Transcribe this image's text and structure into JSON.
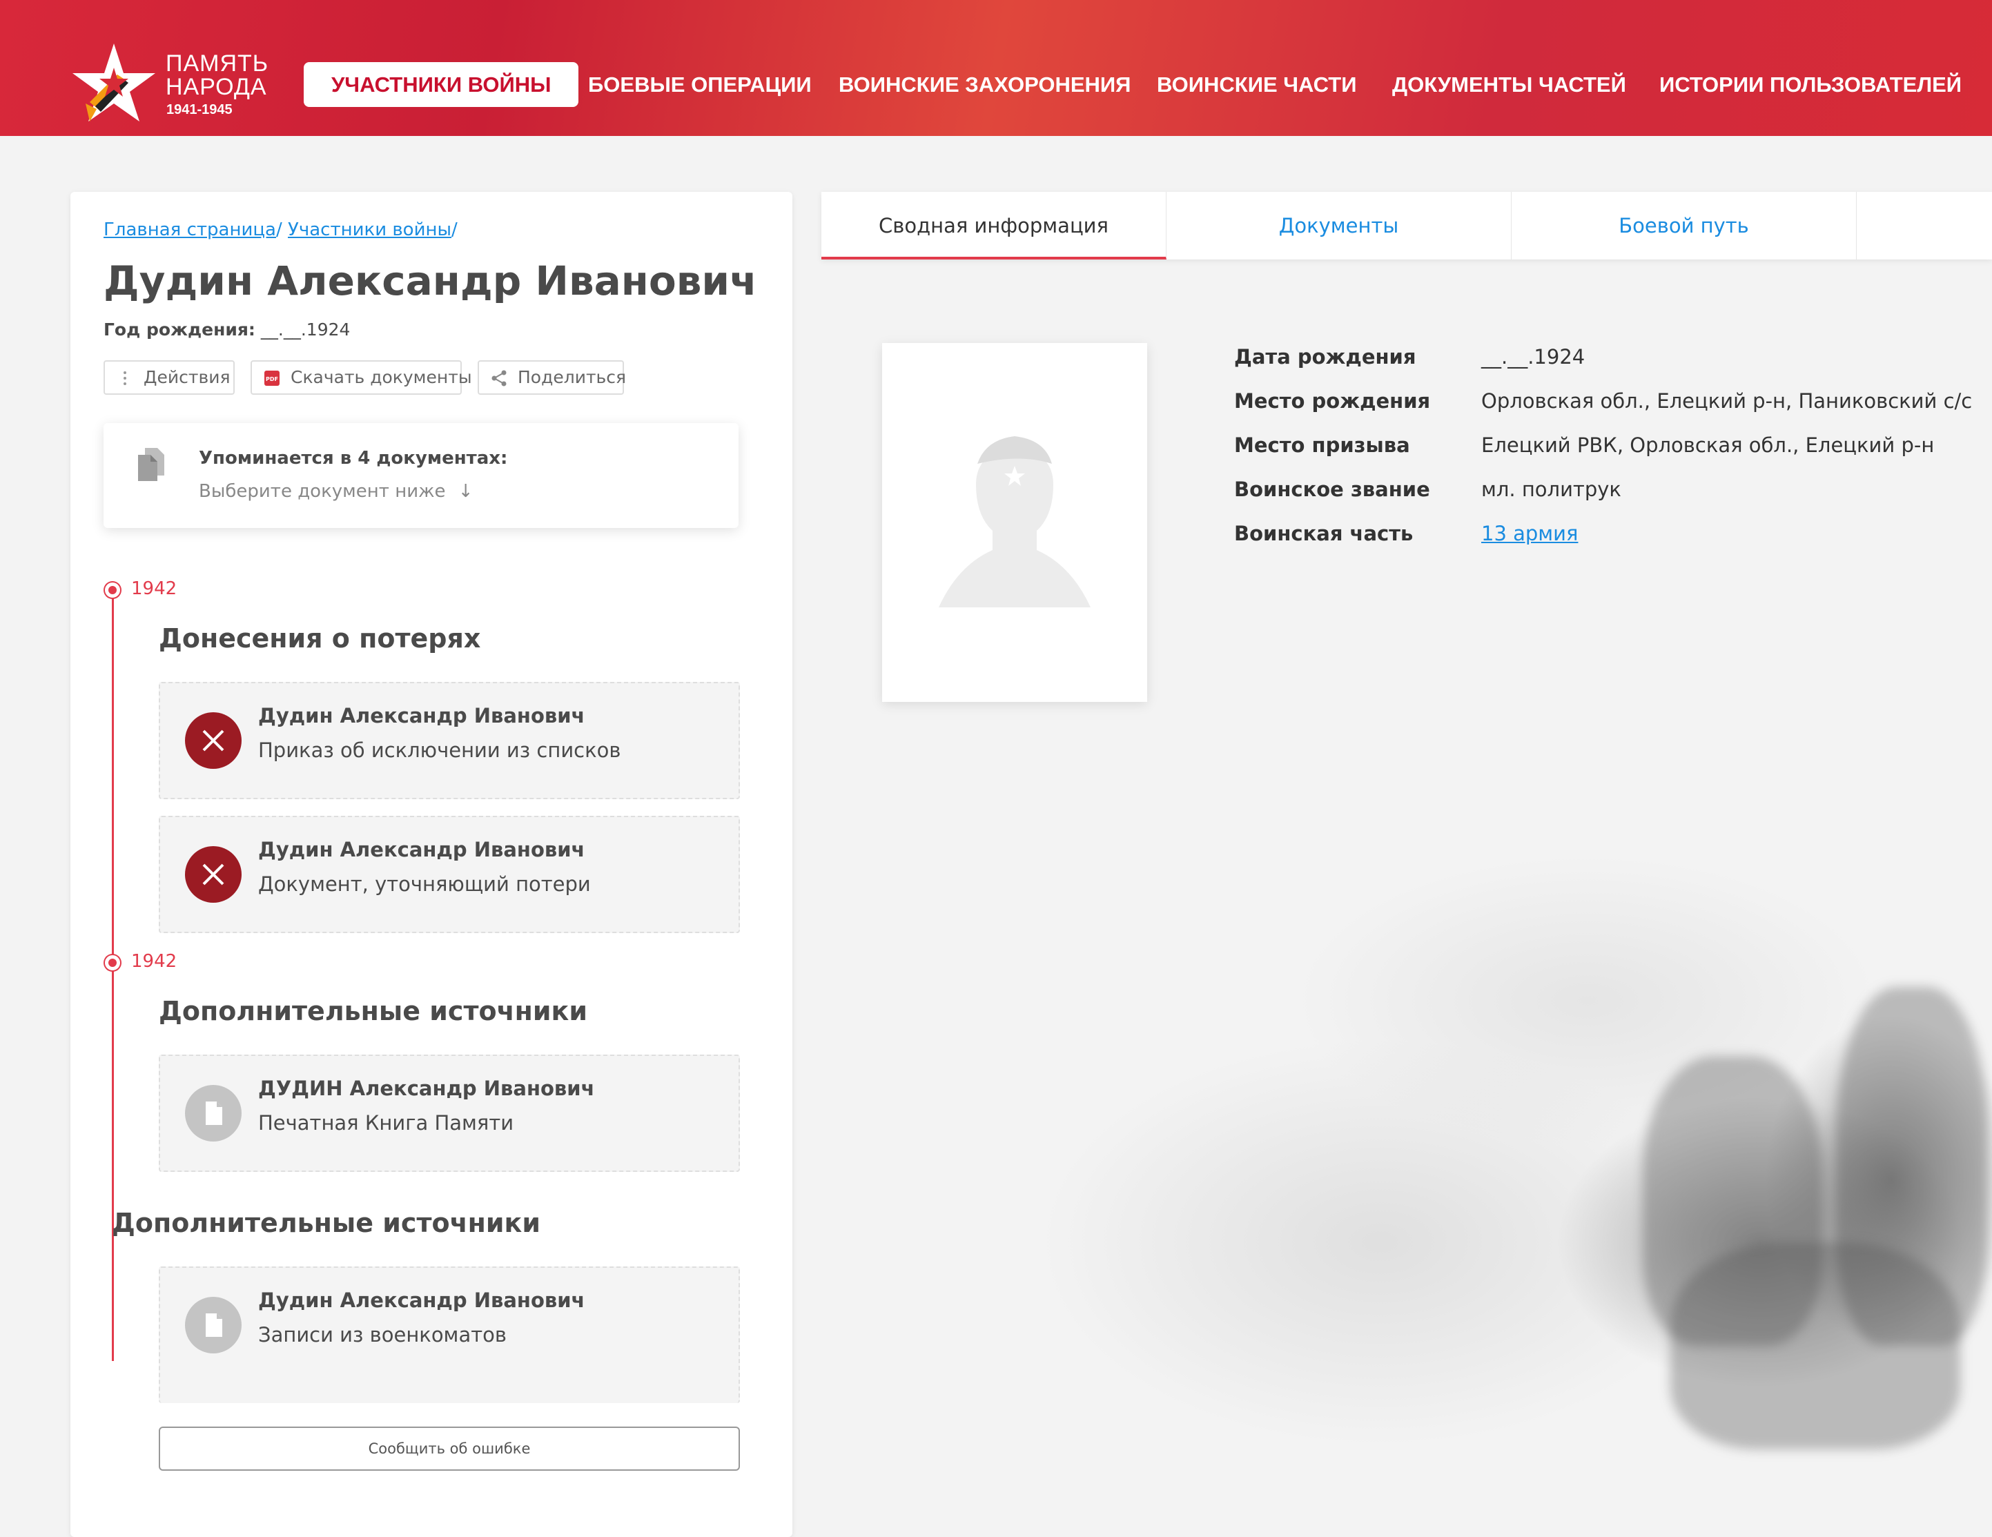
{
  "header": {
    "logo_line1": "ПАМЯТЬ",
    "logo_line2": "НАРОДА",
    "logo_years": "1941-1945",
    "nav": [
      {
        "label": "УЧАСТНИКИ ВОЙНЫ",
        "active": true
      },
      {
        "label": "БОЕВЫЕ ОПЕРАЦИИ"
      },
      {
        "label": "ВОИНСКИЕ ЗАХОРОНЕНИЯ"
      },
      {
        "label": "ВОИНСКИЕ ЧАСТИ"
      },
      {
        "label": "ДОКУМЕНТЫ ЧАСТЕЙ"
      },
      {
        "label": "ИСТОРИИ ПОЛЬЗОВАТЕЛЕЙ"
      }
    ],
    "colors": {
      "brand_red": "#d72b37",
      "active_text": "#c8102e"
    }
  },
  "breadcrumb": {
    "home": "Главная страница",
    "section": "Участники войны",
    "separator": "/"
  },
  "person": {
    "name": "Дудин Александр Иванович",
    "birth_label": "Год рождения:",
    "birth_value": "__.__.1924"
  },
  "actions": {
    "actions_label": "Действия",
    "download_label": "Скачать документы",
    "share_label": "Поделиться"
  },
  "mentions": {
    "title": "Упоминается в 4 документах:",
    "subtitle": "Выберите документ ниже",
    "arrow": "↓"
  },
  "timeline": [
    {
      "year": "1942",
      "section": "Донесения о потерях",
      "docs": [
        {
          "name": "Дудин Александр Иванович",
          "type": "Приказ об исключении из списков",
          "icon": "close-icon"
        },
        {
          "name": "Дудин Александр Иванович",
          "type": "Документ, уточняющий потери",
          "icon": "close-icon"
        }
      ]
    },
    {
      "year": "1942",
      "section": "Дополнительные источники",
      "docs": [
        {
          "name": "ДУДИН Александр Иванович",
          "type": "Печатная Книга Памяти",
          "icon": "document-icon"
        }
      ]
    }
  ],
  "extra": {
    "section": "Дополнительные источники",
    "docs": [
      {
        "name": "Дудин Александр Иванович",
        "type": "Записи из военкоматов",
        "icon": "document-icon"
      }
    ]
  },
  "report_button": "Сообщить об ошибке",
  "tabs": [
    {
      "label": "Сводная информация",
      "active": true
    },
    {
      "label": "Документы"
    },
    {
      "label": "Боевой путь"
    }
  ],
  "info": [
    {
      "label": "Дата рождения",
      "value": "__.__.1924"
    },
    {
      "label": "Место рождения",
      "value": "Орловская обл., Елецкий р-н, Паниковский с/с"
    },
    {
      "label": "Место призыва",
      "value": "Елецкий РВК, Орловская обл., Елецкий р-н"
    },
    {
      "label": "Воинское звание",
      "value": "мл. политрук"
    },
    {
      "label": "Воинская часть",
      "value": "13 армия",
      "link": true
    }
  ]
}
